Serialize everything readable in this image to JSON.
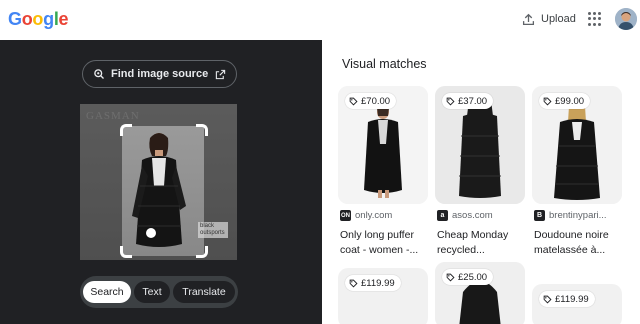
{
  "header": {
    "logo": "Google",
    "upload_label": "Upload",
    "apps_icon": "apps-grid-icon",
    "avatar_icon": "account-avatar"
  },
  "left_panel": {
    "find_source_label": "Find image source",
    "watermark": "GASMAN",
    "stock_tag": "black outsports",
    "modes": [
      {
        "label": "Search",
        "active": true
      },
      {
        "label": "Text",
        "active": false
      },
      {
        "label": "Translate",
        "active": false
      }
    ]
  },
  "results": {
    "title": "Visual matches",
    "cards": [
      {
        "price": "£70.00",
        "source": "only.com",
        "title_lines": [
          "Only long puffer",
          "coat - women -..."
        ],
        "favicon": "ON"
      },
      {
        "price": "£37.00",
        "source": "asos.com",
        "title_lines": [
          "Cheap Monday",
          "recycled..."
        ],
        "favicon": "a"
      },
      {
        "price": "£99.00",
        "source": "brentinypari...",
        "title_lines": [
          "Doudoune noire",
          "matelassée à..."
        ],
        "favicon": "B"
      },
      {
        "price": "£119.99"
      },
      {
        "price": "£25.00"
      },
      {
        "price": "£119.99"
      }
    ]
  },
  "colors": {
    "left_bg": "#202124",
    "accent_blue": "#4285F4"
  }
}
